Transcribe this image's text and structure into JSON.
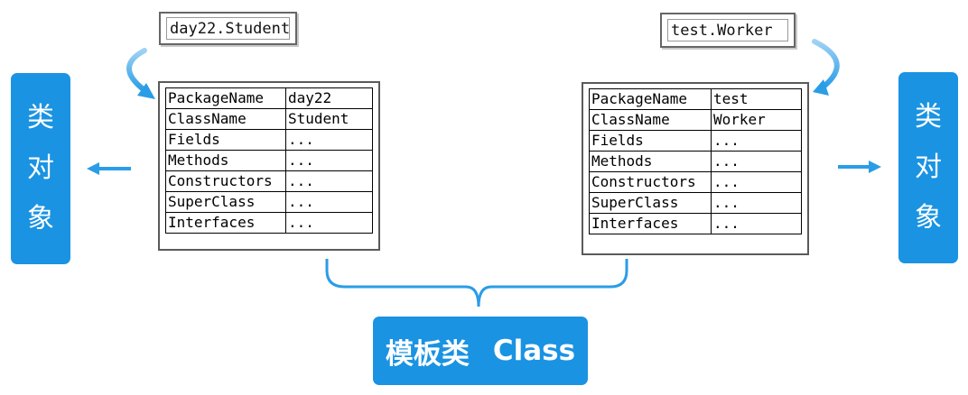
{
  "left": {
    "tag": "day22.Student",
    "side_label": [
      "类",
      "对",
      "象"
    ],
    "rows": [
      [
        "PackageName",
        "day22"
      ],
      [
        "ClassName",
        "Student"
      ],
      [
        "Fields",
        "..."
      ],
      [
        "Methods",
        "..."
      ],
      [
        "Constructors",
        "..."
      ],
      [
        "SuperClass",
        "..."
      ],
      [
        "Interfaces",
        "..."
      ]
    ]
  },
  "right": {
    "tag": "test.Worker",
    "side_label": [
      "类",
      "对",
      "象"
    ],
    "rows": [
      [
        "PackageName",
        "test"
      ],
      [
        "ClassName",
        "Worker"
      ],
      [
        "Fields",
        "..."
      ],
      [
        "Methods",
        "..."
      ],
      [
        "Constructors",
        "..."
      ],
      [
        "SuperClass",
        "..."
      ],
      [
        "Interfaces",
        "..."
      ]
    ]
  },
  "bottom": {
    "label_cn": "模板类",
    "label_en": "Class"
  },
  "colors": {
    "accent": "#1a93e2",
    "arrow": "#2a9de6"
  }
}
